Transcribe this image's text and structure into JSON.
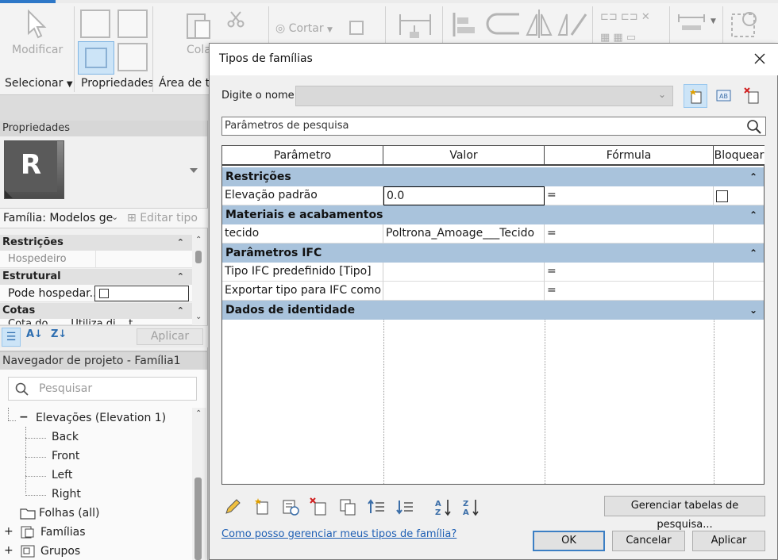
{
  "ribbon": {
    "modify_label": "Modificar",
    "select_label": "Selecionar",
    "properties_label": "Propriedades",
    "clipboard_label": "Área de tra",
    "paste_label": "Cola",
    "cut_label": "Cortar"
  },
  "properties": {
    "title": "Propriedades",
    "family_label": "Família: Modelos ge",
    "edit_type_label": "Editar tipo",
    "categories": [
      {
        "name": "Restrições"
      },
      {
        "name": "Estrutural"
      },
      {
        "name": "Cotas"
      }
    ],
    "host_label": "Hospedeiro",
    "can_host_label": "Pode hospedar...",
    "cotas_partial": "Cota do ... . Utiliza di... t",
    "apply_label": "Aplicar"
  },
  "browser": {
    "title": "Navegador de projeto - Família1",
    "search_placeholder": "Pesquisar",
    "elevations_label": "Elevações (Elevation 1)",
    "elevation_items": [
      "Back",
      "Front",
      "Left",
      "Right"
    ],
    "sheets_label": "Folhas (all)",
    "families_label": "Famílias",
    "groups_label": "Grupos"
  },
  "dialog": {
    "title": "Tipos de famílias",
    "name_label": "Digite o nome:",
    "search_param_text": "Parâmetros de pesquisa",
    "columns": [
      "Parâmetro",
      "Valor",
      "Fórmula",
      "Bloquear"
    ],
    "groups": [
      {
        "name": "Restrições",
        "rows": [
          {
            "param": "Elevação padrão",
            "value": "0.0",
            "formula": "=",
            "lock": true
          }
        ]
      },
      {
        "name": "Materiais e acabamentos",
        "rows": [
          {
            "param": "tecido",
            "value": "Poltrona_Amoage___Tecido",
            "formula": "=",
            "lock": false
          }
        ]
      },
      {
        "name": "Parâmetros IFC",
        "rows": [
          {
            "param": "Tipo IFC predefinido [Tipo]",
            "value": "",
            "formula": "=",
            "lock": false
          },
          {
            "param": "Exportar tipo para IFC como",
            "value": "",
            "formula": "=",
            "lock": false
          }
        ]
      },
      {
        "name": "Dados de identidade",
        "rows": []
      }
    ],
    "manage_lookup_label": "Gerenciar tabelas de pesquisa...",
    "help_link": "Como posso gerenciar meus tipos de família?",
    "ok_label": "OK",
    "cancel_label": "Cancelar",
    "apply_label": "Aplicar"
  },
  "colors": {
    "group_header": "#a9c3dc",
    "accent": "#3c7fc4",
    "link": "#1e5fb4"
  }
}
